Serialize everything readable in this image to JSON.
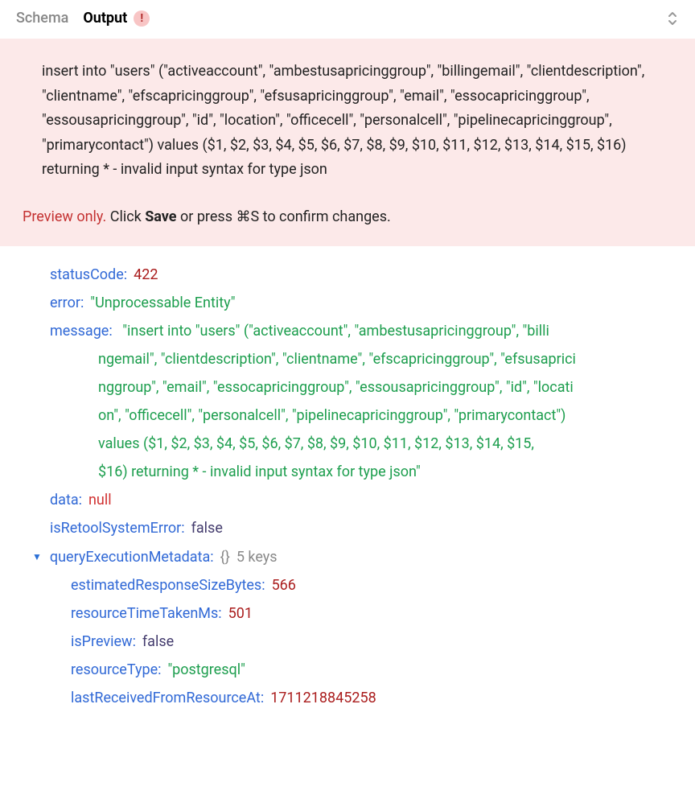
{
  "tabs": {
    "schema": "Schema",
    "output": "Output",
    "warning": "!"
  },
  "error": {
    "text": "insert into \"users\" (\"activeaccount\", \"ambestusapricinggroup\", \"billingemail\", \"clientdescription\", \"clientname\", \"efscapricinggroup\", \"efsusapricinggroup\", \"email\", \"essocapricinggroup\", \"essousapricinggroup\", \"id\", \"location\", \"officecell\", \"personalcell\", \"pipelinecapricinggroup\", \"primarycontact\") values ($1, $2, $3, $4, $5, $6, $7, $8, $9, $10, $11, $12, $13, $14, $15, $16) returning * - invalid input syntax for type json",
    "preview_only": "Preview only.",
    "preview_click": " Click ",
    "preview_save": "Save",
    "preview_or": " or press ⌘S to confirm changes."
  },
  "json": {
    "statusCode": {
      "key": "statusCode",
      "value": "422"
    },
    "errorField": {
      "key": "error",
      "value": "\"Unprocessable Entity\""
    },
    "message": {
      "key": "message",
      "line1": "\"insert into \"users\" (\"activeaccount\", \"ambestusapricinggroup\", \"billi",
      "line2": "ngemail\", \"clientdescription\", \"clientname\", \"efscapricinggroup\", \"efsusaprici",
      "line3": "nggroup\", \"email\", \"essocapricinggroup\", \"essousapricinggroup\", \"id\", \"locati",
      "line4": "on\", \"officecell\", \"personalcell\", \"pipelinecapricinggroup\", \"primarycontact\")",
      "line5": "values ($1, $2, $3, $4, $5, $6, $7, $8, $9, $10, $11, $12, $13, $14, $15,",
      "line6": "$16) returning * - invalid input syntax for type json\""
    },
    "data": {
      "key": "data",
      "value": "null"
    },
    "isRetoolSystemError": {
      "key": "isRetoolSystemError",
      "value": "false"
    },
    "queryExecutionMetadata": {
      "key": "queryExecutionMetadata",
      "meta": "5 keys",
      "estimatedResponseSizeBytes": {
        "key": "estimatedResponseSizeBytes",
        "value": "566"
      },
      "resourceTimeTakenMs": {
        "key": "resourceTimeTakenMs",
        "value": "501"
      },
      "isPreview": {
        "key": "isPreview",
        "value": "false"
      },
      "resourceType": {
        "key": "resourceType",
        "value": "\"postgresql\""
      },
      "lastReceivedFromResourceAt": {
        "key": "lastReceivedFromResourceAt",
        "value": "1711218845258"
      }
    }
  }
}
